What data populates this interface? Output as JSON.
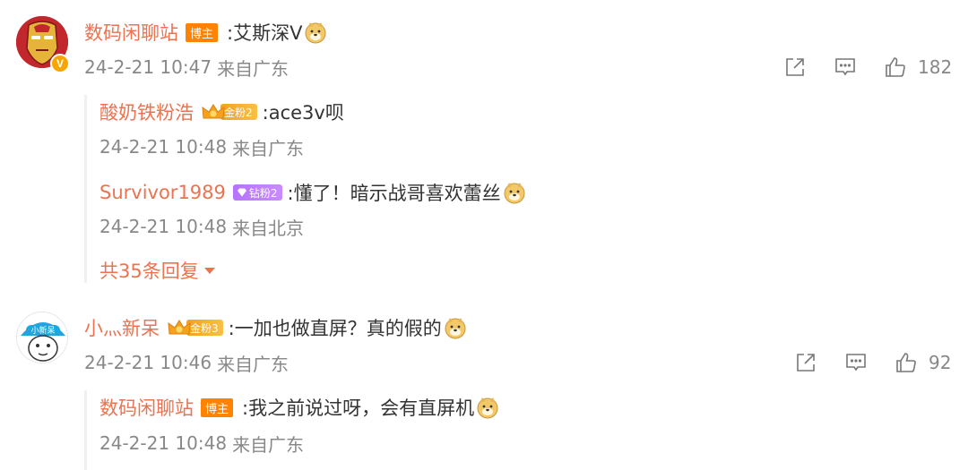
{
  "comments": [
    {
      "author": "数码闲聊站",
      "author_badge": "博主",
      "text": ":艾斯深V",
      "time": "24-2-21 10:47",
      "location": "来自广东",
      "likes": "182",
      "verified_badge": "V",
      "replies": [
        {
          "author": "酸奶铁粉浩",
          "fan_badge": "金粉2",
          "text": ":ace3v呗",
          "time": "24-2-21 10:48",
          "location": "来自广东"
        },
        {
          "author": "Survivor1989",
          "fan_badge": "钻粉2",
          "text": ":懂了！暗示战哥喜欢蕾丝",
          "time": "24-2-21 10:48",
          "location": "来自北京"
        }
      ],
      "more_replies": "共35条回复"
    },
    {
      "author": "小灬新呆",
      "fan_badge": "金粉3",
      "text": ":一加也做直屏？真的假的",
      "time": "24-2-21 10:46",
      "location": "来自广东",
      "likes": "92",
      "avatar_text": "小新呆",
      "replies": [
        {
          "author": "数码闲聊站",
          "author_badge": "博主",
          "text": ":我之前说过呀，会有直屏机",
          "time": "24-2-21 10:48",
          "location": "来自广东"
        }
      ]
    }
  ],
  "colors": {
    "name": "#eb7350",
    "text": "#333333",
    "meta": "#888888",
    "host_badge": "#ff8200",
    "gold_fan": "#f3a21c",
    "diamond_fan": "#b673ff"
  },
  "icons": [
    "repost-icon",
    "comment-icon",
    "like-icon",
    "doge-emoji-icon",
    "crown-icon",
    "diamond-icon",
    "caret-down-icon",
    "verified-badge-icon"
  ]
}
